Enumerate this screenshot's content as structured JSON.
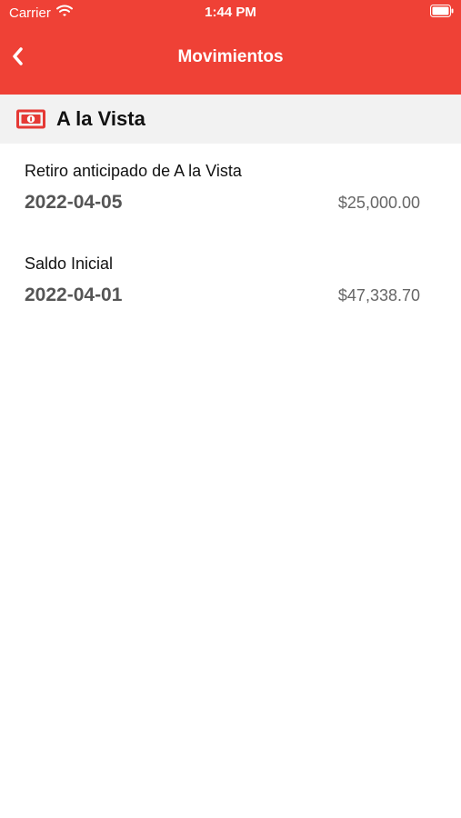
{
  "status_bar": {
    "carrier": "Carrier",
    "time": "1:44 PM"
  },
  "nav": {
    "title": "Movimientos",
    "back_icon": "chevron-left-icon"
  },
  "account": {
    "icon": "money-bill-icon",
    "name": "A la Vista"
  },
  "movements": [
    {
      "description": "Retiro anticipado de A la Vista",
      "date": "2022-04-05",
      "amount": "$25,000.00"
    },
    {
      "description": "Saldo Inicial",
      "date": "2022-04-01",
      "amount": "$47,338.70"
    }
  ],
  "colors": {
    "brand": "#ef4136",
    "section_bg": "#f2f2f2"
  }
}
